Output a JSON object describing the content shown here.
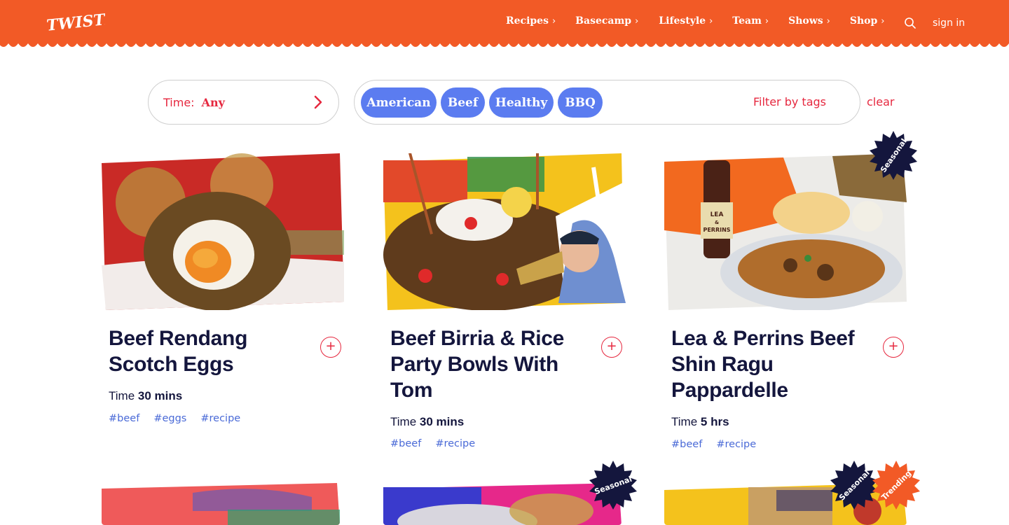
{
  "header": {
    "logo_text": "TWISTED",
    "nav": [
      {
        "label": "Recipes"
      },
      {
        "label": "Basecamp"
      },
      {
        "label": "Lifestyle"
      },
      {
        "label": "Team"
      },
      {
        "label": "Shows"
      },
      {
        "label": "Shop"
      }
    ],
    "search_icon": "search-icon",
    "signin_label": "sign in",
    "accent_color": "#f25a26"
  },
  "filters": {
    "time_label": "Time:",
    "time_value": "Any",
    "tags": [
      "American",
      "Beef",
      "Healthy",
      "BBQ"
    ],
    "filter_placeholder": "Filter by tags",
    "clear_label": "clear",
    "tag_color": "#5b7cf0",
    "accent_color": "#e6283f"
  },
  "cards": [
    {
      "title_lines": [
        "Beef Rendang",
        "Scotch Eggs"
      ],
      "time_label": "Time",
      "time_value": "30 mins",
      "tags": [
        "#beef",
        "#eggs",
        "#recipe"
      ],
      "badges": []
    },
    {
      "title_lines": [
        "Beef Birria & Rice",
        "Party Bowls With",
        "Tom"
      ],
      "time_label": "Time",
      "time_value": "30 mins",
      "tags": [
        "#beef",
        "#recipe"
      ],
      "badges": []
    },
    {
      "title_lines": [
        "Lea & Perrins Beef",
        "Shin Ragu",
        "Pappardelle"
      ],
      "time_label": "Time",
      "time_value": "5 hrs",
      "tags": [
        "#beef",
        "#recipe"
      ],
      "badges": [
        "Seasonal"
      ]
    }
  ],
  "row2_badges": {
    "card2": [
      "Seasonal"
    ],
    "card3": [
      "Seasonal",
      "Trending"
    ]
  },
  "bottle_label": [
    "LEA",
    "&",
    "PERRINS"
  ]
}
